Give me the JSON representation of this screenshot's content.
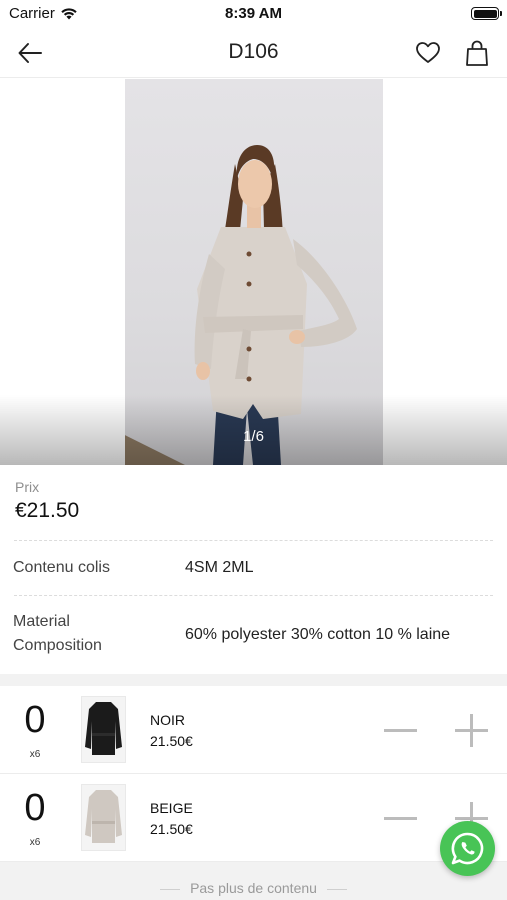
{
  "status_bar": {
    "carrier": "Carrier",
    "time": "8:39 AM"
  },
  "nav": {
    "title": "D106"
  },
  "gallery": {
    "counter": "1/6",
    "current": 1,
    "total": 6
  },
  "price": {
    "label": "Prix",
    "value": "€21.50"
  },
  "specs": [
    {
      "label": "Contenu colis",
      "value": "4SM 2ML"
    },
    {
      "label": "Material Composition",
      "value": "60% polyester 30% cotton 10 % laine"
    }
  ],
  "variants": [
    {
      "quantity": "0",
      "multiplier": "x6",
      "color": "NOIR",
      "price": "21.50€",
      "swatch": "#1b1b1b"
    },
    {
      "quantity": "0",
      "multiplier": "x6",
      "color": "BEIGE",
      "price": "21.50€",
      "swatch": "#cfc8c1"
    }
  ],
  "footer": {
    "end_note": "Pas plus de contenu"
  },
  "colors": {
    "whatsapp": "#48c456",
    "divider": "#dcdcdc",
    "band": "#f2f2f2"
  }
}
